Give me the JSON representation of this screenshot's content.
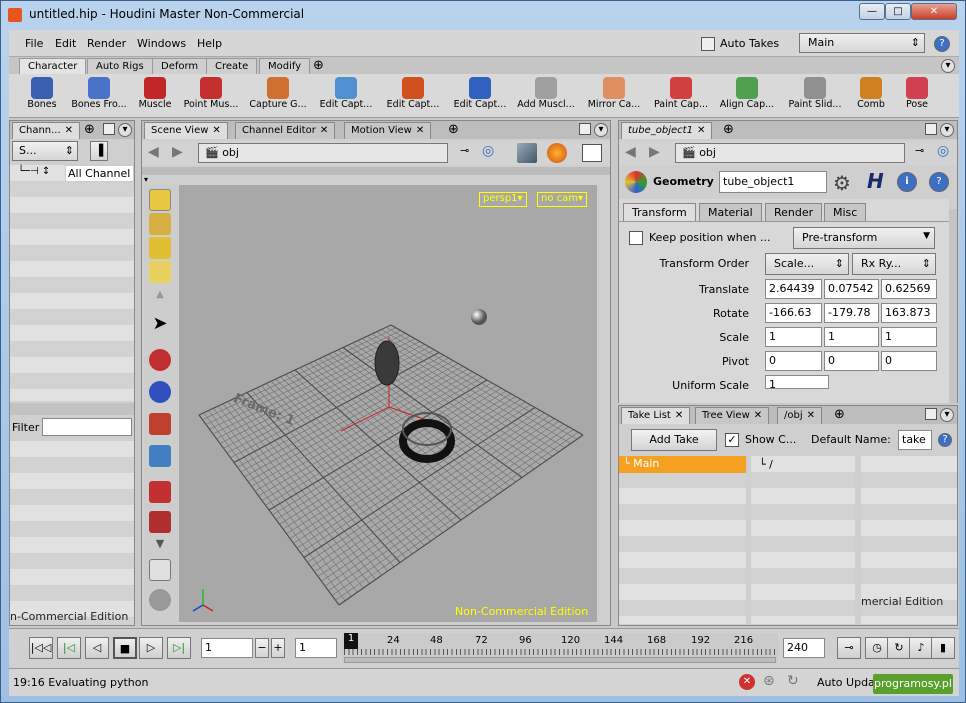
{
  "window": {
    "title": "untitled.hip - Houdini Master Non-Commercial",
    "controls": [
      "—",
      "□",
      "✕"
    ]
  },
  "menu": {
    "items": [
      "File",
      "Edit",
      "Render",
      "Windows",
      "Help"
    ],
    "auto_takes_label": "Auto Takes",
    "take_value": "Main",
    "help_glyph": "?"
  },
  "shelf": {
    "tabs": [
      "Character",
      "Auto Rigs",
      "Deform",
      "Create",
      "Modify"
    ],
    "add_glyph": "⊕",
    "tools": [
      {
        "label": "Bones",
        "color": "#3b5fb0"
      },
      {
        "label": "Bones Fro...",
        "color": "#4a72c8"
      },
      {
        "label": "Muscle",
        "color": "#c02828"
      },
      {
        "label": "Point Mus...",
        "color": "#c43030"
      },
      {
        "label": "Capture G...",
        "color": "#d07030"
      },
      {
        "label": "Edit Capt...",
        "color": "#5090d0"
      },
      {
        "label": "Edit Capt...",
        "color": "#d05020"
      },
      {
        "label": "Edit Capt...",
        "color": "#3060c0"
      },
      {
        "label": "Add Muscl...",
        "color": "#a0a0a0"
      },
      {
        "label": "Mirror Ca...",
        "color": "#e09060"
      },
      {
        "label": "Paint Cap...",
        "color": "#d04040"
      },
      {
        "label": "Align Cap...",
        "color": "#50a050"
      },
      {
        "label": "Paint Slid...",
        "color": "#909090"
      },
      {
        "label": "Comb",
        "color": "#d08020"
      },
      {
        "label": "Pose",
        "color": "#d04050"
      }
    ]
  },
  "channel_pane": {
    "tab": "Chann...",
    "selector": "S...",
    "item": "All Channel",
    "filter_label": "Filter",
    "watermark": "n-Commercial Edition"
  },
  "scene_pane": {
    "tabs": [
      "Scene View",
      "Channel Editor",
      "Motion View"
    ],
    "path": "obj",
    "persp": "persp1▾",
    "cam": "no cam▾",
    "frame_label": "Frame: 1",
    "watermark": "Non-Commercial Edition"
  },
  "param_pane": {
    "tab": "tube_object1",
    "path": "obj",
    "node_type": "Geometry",
    "node_name": "tube_object1",
    "subtabs": [
      "Transform",
      "Material",
      "Render",
      "Misc"
    ],
    "keep_position_label": "Keep position when ...",
    "pre_transform": "Pre-transform",
    "transform_order_label": "Transform Order",
    "transform_order_a": "Scale...",
    "transform_order_b": "Rx Ry...",
    "rows": [
      {
        "label": "Translate",
        "values": [
          "2.64439",
          "0.07542",
          "0.62569"
        ]
      },
      {
        "label": "Rotate",
        "values": [
          "-166.63",
          "-179.78",
          "163.873"
        ]
      },
      {
        "label": "Scale",
        "values": [
          "1",
          "1",
          "1"
        ]
      },
      {
        "label": "Pivot",
        "values": [
          "0",
          "0",
          "0"
        ]
      }
    ],
    "uniform_scale_label": "Uniform Scale",
    "uniform_scale_value": "1"
  },
  "take_pane": {
    "tabs": [
      "Take List",
      "Tree View",
      "/obj"
    ],
    "add_take": "Add Take",
    "show_label": "Show C...",
    "default_name_label": "Default Name:",
    "default_name_value": "take",
    "take_item": "Main",
    "tree_item": "/",
    "watermark": "mercial Edition"
  },
  "playbar": {
    "frame": "1",
    "step": "1",
    "end": "240",
    "cursor_frame": "1",
    "ticks": [
      "24",
      "48",
      "72",
      "96",
      "120",
      "144",
      "168",
      "192",
      "216"
    ]
  },
  "status": {
    "message": "19:16 Evaluating python",
    "auto_update": "Auto Update",
    "badge": "programosy.pl"
  }
}
